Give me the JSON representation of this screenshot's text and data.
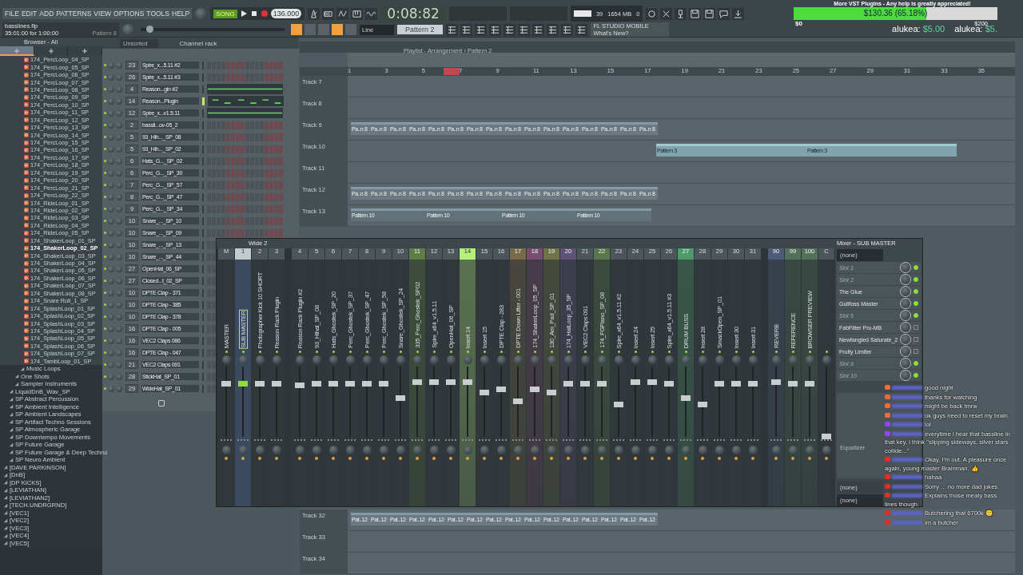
{
  "menu": [
    "FILE",
    "EDIT",
    "ADD",
    "PATTERNS",
    "VIEW",
    "OPTIONS",
    "TOOLS",
    "HELP"
  ],
  "transport": {
    "mode_label": "SONG",
    "tempo": "136.000",
    "time": "0:08:82",
    "cpu": "39",
    "memory": "1654 MB",
    "polyphony": "0"
  },
  "project": {
    "file": "basslines.flp",
    "info": "35:01:00 for 1:00:00",
    "pattern": "Pattern 8",
    "position": {
      "level": 0.04
    }
  },
  "toolbar2": {
    "snap": "Line",
    "pattern": "Pattern 2",
    "news_title": "FL STUDIO MOBILE",
    "news_link": "What's New?"
  },
  "donation": {
    "title": "More VST Plugins - Any help is greatly appreciated!",
    "amount": "$130.36 (65.18%)",
    "level": 0.6518,
    "min": "$0",
    "max": "$200",
    "donors": [
      {
        "name": "alukea:",
        "amount": "$5.00"
      },
      {
        "name": "alukea:",
        "amount": "$5."
      }
    ]
  },
  "browser": {
    "title": "Browser - All",
    "tabs": [
      {
        "selected": true
      },
      {
        "selected": false
      },
      {
        "selected": false
      }
    ],
    "tree": [
      {
        "children": [
          {
            "children": [
              {
                "children": [
                  {
                    "children": [
                      {
                        "label": "174_PercLoop_04_SP",
                        "selected": false
                      },
                      {
                        "label": "174_PercLoop_05_SP",
                        "selected": false
                      },
                      {
                        "label": "174_PercLoop_06_SP",
                        "selected": false
                      },
                      {
                        "label": "174_PercLoop_07_SP",
                        "selected": false
                      },
                      {
                        "label": "174_PercLoop_08_SP",
                        "selected": false
                      },
                      {
                        "label": "174_PercLoop_09_SP",
                        "selected": false
                      },
                      {
                        "label": "174_PercLoop_10_SP",
                        "selected": false
                      },
                      {
                        "label": "174_PercLoop_11_SP",
                        "selected": false
                      },
                      {
                        "label": "174_PercLoop_12_SP",
                        "selected": false
                      },
                      {
                        "label": "174_PercLoop_13_SP",
                        "selected": false
                      },
                      {
                        "label": "174_PercLoop_14_SP",
                        "selected": false
                      },
                      {
                        "label": "174_PercLoop_15_SP",
                        "selected": false
                      },
                      {
                        "label": "174_PercLoop_16_SP",
                        "selected": false
                      },
                      {
                        "label": "174_PercLoop_17_SP",
                        "selected": false
                      },
                      {
                        "label": "174_PercLoop_18_SP",
                        "selected": false
                      },
                      {
                        "label": "174_PercLoop_19_SP",
                        "selected": false
                      },
                      {
                        "label": "174_PercLoop_20_SP",
                        "selected": false
                      },
                      {
                        "label": "174_PercLoop_21_SP",
                        "selected": false
                      },
                      {
                        "label": "174_PercLoop_22_SP",
                        "selected": false
                      },
                      {
                        "label": "174_RideLoop_01_SP",
                        "selected": false
                      },
                      {
                        "label": "174_RideLoop_02_SP",
                        "selected": false
                      },
                      {
                        "label": "174_RideLoop_03_SP",
                        "selected": false
                      },
                      {
                        "label": "174_RideLoop_04_SP",
                        "selected": false
                      },
                      {
                        "label": "174_RideLoop_05_SP",
                        "selected": false
                      },
                      {
                        "label": "174_ShakerLoop_01_SP",
                        "selected": false
                      },
                      {
                        "label": "174_ShakerLoop_02_SP",
                        "selected": true
                      },
                      {
                        "label": "174_ShakerLoop_03_SP",
                        "selected": false
                      },
                      {
                        "label": "174_ShakerLoop_04_SP",
                        "selected": false
                      },
                      {
                        "label": "174_ShakerLoop_05_SP",
                        "selected": false
                      },
                      {
                        "label": "174_ShakerLoop_06_SP",
                        "selected": false
                      },
                      {
                        "label": "174_ShakerLoop_07_SP",
                        "selected": false
                      },
                      {
                        "label": "174_ShakerLoop_08_SP",
                        "selected": false
                      },
                      {
                        "label": "174_Snare Roll_1_SP",
                        "selected": false
                      },
                      {
                        "label": "174_SplashLoop_01_SP",
                        "selected": false
                      },
                      {
                        "label": "174_SplashLoop_02_SP",
                        "selected": false
                      },
                      {
                        "label": "174_SplashLoop_03_SP",
                        "selected": false
                      },
                      {
                        "label": "174_SplashLoop_04_SP",
                        "selected": false
                      },
                      {
                        "label": "174_SplashLoop_05_SP",
                        "selected": false
                      },
                      {
                        "label": "174_SplashLoop_06_SP",
                        "selected": false
                      },
                      {
                        "label": "174_SplashLoop_07_SP",
                        "selected": false
                      },
                      {
                        "label": "174_TambLoop_01_SP",
                        "selected": false
                      }
                    ]
                  },
                  {
                    "label": "Music Loops"
                  }
                ]
              },
              {
                "label": "One Shots"
              },
              {
                "label": "Sampler Instruments"
              }
            ]
          },
          {
            "label": "LiquidDnB_Wav_SP"
          },
          {
            "label": "SP Abstract Percussion"
          },
          {
            "label": "SP Ambient Intelligence"
          },
          {
            "label": "SP Ambient Landscapes"
          },
          {
            "label": "SP Artifact Techno Sessions"
          },
          {
            "label": "SP Atmospheric Garage"
          },
          {
            "label": "SP Downtempo Movements"
          },
          {
            "label": "SP Future Garage"
          },
          {
            "label": "SP Future Garage & Deep Techno"
          },
          {
            "label": "SP Neuro Ambient"
          }
        ]
      },
      {
        "label": "[DAVE PARKINSON]"
      },
      {
        "label": "[DnB]"
      },
      {
        "label": "[DP KICKS]"
      },
      {
        "label": "[LEVIATHAN]"
      },
      {
        "label": "[LEVIATHAN2]"
      },
      {
        "label": "[TECH.UNDRGRND]"
      },
      {
        "label": "[VEC1]"
      },
      {
        "label": "[VEC2]"
      },
      {
        "label": "[VEC3]"
      },
      {
        "label": "[VEC4]"
      },
      {
        "label": "[VEC5]"
      }
    ]
  },
  "channel_rack": {
    "title": "Channel rack",
    "filter": "Unsorted",
    "channels": [
      {
        "number": "23",
        "name": "Spire_x...5.11 #2",
        "kind": "steps",
        "selected": false
      },
      {
        "number": "26",
        "name": "Spire_x...5.11 #3",
        "kind": "steps",
        "selected": false
      },
      {
        "number": "4",
        "name": "Reason...gin #2",
        "kind": "piano",
        "selected": false
      },
      {
        "number": "14",
        "name": "Reason...Plugin",
        "kind": "piano",
        "selected": true
      },
      {
        "number": "12",
        "name": "Spire_x...v1.5.11",
        "kind": "piano",
        "selected": false
      },
      {
        "number": "2",
        "name": "bassli...ov-05_2",
        "kind": "steps",
        "selected": false
      },
      {
        "number": "5",
        "name": "93_Hih..._SP_08",
        "kind": "steps",
        "selected": false
      },
      {
        "number": "5",
        "name": "93_Hih..._SP_02",
        "kind": "steps",
        "selected": false
      },
      {
        "number": "6",
        "name": "Hats_G..._SP_02",
        "kind": "steps",
        "selected": false
      },
      {
        "number": "6",
        "name": "Perc_G..._SP_30",
        "kind": "steps",
        "selected": false
      },
      {
        "number": "7",
        "name": "Perc_G..._SP_57",
        "kind": "steps",
        "selected": false
      },
      {
        "number": "8",
        "name": "Perc_G..._SP_47",
        "kind": "steps",
        "selected": false
      },
      {
        "number": "9",
        "name": "Perc_G..._SP_34",
        "kind": "steps",
        "selected": false
      },
      {
        "number": "10",
        "name": "Snare_..._SP_10",
        "kind": "steps",
        "selected": false
      },
      {
        "number": "10",
        "name": "Snare_..._SP_09",
        "kind": "steps",
        "selected": false
      },
      {
        "number": "10",
        "name": "Snare_..._SP_13",
        "kind": "steps",
        "selected": false
      },
      {
        "number": "10",
        "name": "Snare_..._SP_44",
        "kind": "steps",
        "selected": false
      },
      {
        "number": "27",
        "name": "OpenHat_06_SP",
        "kind": "steps",
        "selected": false
      },
      {
        "number": "27",
        "name": "Closed...t_02_SP",
        "kind": "steps",
        "selected": false
      },
      {
        "number": "10",
        "name": "DPTE Clap - 371",
        "kind": "steps",
        "selected": false
      },
      {
        "number": "10",
        "name": "DPTE Clap - 385",
        "kind": "steps",
        "selected": false
      },
      {
        "number": "10",
        "name": "DPTE Clap - 378",
        "kind": "steps",
        "selected": false
      },
      {
        "number": "16",
        "name": "DPTE Clap - 005",
        "kind": "steps",
        "selected": false
      },
      {
        "number": "16",
        "name": "VEC2 Claps 086",
        "kind": "steps",
        "selected": false
      },
      {
        "number": "16",
        "name": "DPTE Clap - 047",
        "kind": "steps",
        "selected": false
      },
      {
        "number": "21",
        "name": "VEC2 Claps 091",
        "kind": "steps",
        "selected": false
      },
      {
        "number": "28",
        "name": "StickHat_SP_01",
        "kind": "steps",
        "selected": false
      },
      {
        "number": "29",
        "name": "WideHat_SP_01",
        "kind": "steps",
        "selected": false
      }
    ]
  },
  "playlist": {
    "title": "Playlist - Arrangement › Pattern 2",
    "ruler": [
      "1",
      "3",
      "5",
      "7",
      "9",
      "11",
      "13",
      "15",
      "17",
      "19",
      "21",
      "23",
      "25",
      "27",
      "29",
      "31",
      "33",
      "35"
    ],
    "tracks_top": [
      {
        "name": "Track 7"
      },
      {
        "name": "Track 8"
      },
      {
        "name": "Track 9",
        "clips": [
          {
            "label": "Pa..n 8",
            "kind": "short"
          },
          {
            "label": "Pa..n 8",
            "kind": "short"
          },
          {
            "label": "Pa..n 8",
            "kind": "short"
          },
          {
            "label": "Pa..n 8",
            "kind": "short"
          },
          {
            "label": "Pa..n 8",
            "kind": "short"
          },
          {
            "label": "Pa..n 8",
            "kind": "short"
          },
          {
            "label": "Pa..n 8",
            "kind": "short"
          },
          {
            "label": "Pa..n 8",
            "kind": "short"
          },
          {
            "label": "Pa..n 8",
            "kind": "short"
          },
          {
            "label": "Pa..n 8",
            "kind": "short"
          },
          {
            "label": "Pa..n 8",
            "kind": "short"
          },
          {
            "label": "Pa..n 8",
            "kind": "short"
          },
          {
            "label": "Pa..n 8",
            "kind": "short"
          },
          {
            "label": "Pa..n 8",
            "kind": "short"
          },
          {
            "label": "Pa..n 8",
            "kind": "short"
          },
          {
            "label": "Pa..n 8",
            "kind": "short"
          }
        ]
      },
      {
        "name": "Track 10",
        "clips": [
          {
            "label": "Pattern 3",
            "kind": "long"
          },
          {
            "label": "Pattern 3",
            "kind": "long"
          }
        ]
      },
      {
        "name": "Track 11"
      },
      {
        "name": "Track 12",
        "clips": [
          {
            "label": "Pa..n 8",
            "kind": "short"
          },
          {
            "label": "Pa..n 8",
            "kind": "short"
          },
          {
            "label": "Pa..n 8",
            "kind": "short"
          },
          {
            "label": "Pa..n 8",
            "kind": "short"
          },
          {
            "label": "Pa..n 8",
            "kind": "short"
          },
          {
            "label": "Pa..n 8",
            "kind": "short"
          },
          {
            "label": "Pa..n 8",
            "kind": "short"
          },
          {
            "label": "Pa..n 8",
            "kind": "short"
          },
          {
            "label": "Pa..n 8",
            "kind": "short"
          },
          {
            "label": "Pa..n 8",
            "kind": "short"
          },
          {
            "label": "Pa..n 8",
            "kind": "short"
          },
          {
            "label": "Pa..n 8",
            "kind": "short"
          },
          {
            "label": "Pa..n 8",
            "kind": "short"
          },
          {
            "label": "Pa..n 8",
            "kind": "short"
          },
          {
            "label": "Pa..n 8",
            "kind": "short"
          },
          {
            "label": "Pa..n 8",
            "kind": "short"
          }
        ]
      },
      {
        "name": "Track 13",
        "clips": [
          {
            "label": "Pattern 10",
            "kind": "medium"
          },
          {
            "label": "Pattern 10",
            "kind": "medium"
          },
          {
            "label": "Pattern 10",
            "kind": "medium"
          },
          {
            "label": "Pattern 10",
            "kind": "medium"
          }
        ]
      }
    ],
    "tracks_bottom": [
      {
        "name": "Track 32",
        "clips": [
          {
            "label": "Pat..12",
            "kind": "short"
          },
          {
            "label": "Pat..12",
            "kind": "short"
          },
          {
            "label": "Pat..12",
            "kind": "short"
          },
          {
            "label": "Pat..12",
            "kind": "short"
          },
          {
            "label": "Pat..12",
            "kind": "short"
          },
          {
            "label": "Pat..12",
            "kind": "short"
          },
          {
            "label": "Pat..12",
            "kind": "short"
          },
          {
            "label": "Pat..12",
            "kind": "short"
          },
          {
            "label": "Pat..12",
            "kind": "short"
          },
          {
            "label": "Pat..12",
            "kind": "short"
          },
          {
            "label": "Pat..12",
            "kind": "short"
          },
          {
            "label": "Pat..12",
            "kind": "short"
          },
          {
            "label": "Pat..12",
            "kind": "short"
          },
          {
            "label": "Pat..12",
            "kind": "short"
          },
          {
            "label": "Pat..12",
            "kind": "short"
          },
          {
            "label": "Pat..12",
            "kind": "short"
          }
        ]
      },
      {
        "name": "Track 33"
      },
      {
        "name": "Track 34"
      }
    ]
  },
  "mixer": {
    "preset": "Wide 2",
    "strips": [
      {
        "number": "M",
        "name": "MASTER",
        "selected": false,
        "level": 0.75
      },
      {
        "number": "1",
        "name": "SUB MASTER",
        "selected": true,
        "level": 0.75
      },
      {
        "number": "2",
        "name": "Photographer Kick 10 SHORT",
        "selected": false,
        "level": 0.75
      },
      {
        "number": "3",
        "name": "Reason Rack Plugin",
        "selected": false,
        "level": 0.75
      },
      {
        "number": "4",
        "name": "Reason Rack Plugin #2",
        "selected": false,
        "level": 0.73
      },
      {
        "number": "5",
        "name": "93_Hihat_SP_08",
        "selected": false,
        "level": 0.75
      },
      {
        "number": "6",
        "name": "Hats_Ghostek_SP_20",
        "selected": false,
        "level": 0.75
      },
      {
        "number": "7",
        "name": "Perc_Ghostek_SP_37",
        "selected": false,
        "level": 0.75
      },
      {
        "number": "8",
        "name": "Perc_Ghostek_SP_47",
        "selected": false,
        "level": 0.75
      },
      {
        "number": "9",
        "name": "Perc_Ghostek_SP_58",
        "selected": false,
        "level": 0.75
      },
      {
        "number": "10",
        "name": "Snare_Ghostek_SP_24",
        "selected": false,
        "level": 0.55
      },
      {
        "number": "11",
        "name": "335_Perc_Ghostek_SP02",
        "selected": false,
        "level": 0.77,
        "color": "#5f7d45"
      },
      {
        "number": "12",
        "name": "Spire_x64_v1.5.11",
        "selected": false,
        "level": 0.77
      },
      {
        "number": "13",
        "name": "OpenHat_06_SP",
        "selected": false,
        "level": 0.77
      },
      {
        "number": "14",
        "name": "Insert 14",
        "selected": false,
        "level": 0.77,
        "color": "#b4f07c"
      },
      {
        "number": "15",
        "name": "Insert 15",
        "selected": false,
        "level": 0.62
      },
      {
        "number": "16",
        "name": "DPTE Clap - 283",
        "selected": false,
        "level": 0.67
      },
      {
        "number": "17",
        "name": "DPTE Down Lifter - 001",
        "selected": false,
        "level": 0.5,
        "color": "#7a6a4c"
      },
      {
        "number": "18",
        "name": "174_ShakerLoop_05_SP",
        "selected": false,
        "level": 0.67,
        "color": "#7a4c6e"
      },
      {
        "number": "19",
        "name": "130_Am_Pad_SP_01",
        "selected": false,
        "level": 0.62,
        "color": "#6f7448"
      },
      {
        "number": "20",
        "name": "174_HatLoop_35_SP",
        "selected": false,
        "level": 0.75,
        "color": "#5e5278"
      },
      {
        "number": "21",
        "name": "VEC2 Claps 091",
        "selected": false,
        "level": 0.75
      },
      {
        "number": "22",
        "name": "174_FGPiano_SP_08",
        "selected": false,
        "level": 0.75,
        "color": "#58784c"
      },
      {
        "number": "23",
        "name": "Spire_x64_v1.5.11 #2",
        "selected": false,
        "level": 0.45
      },
      {
        "number": "24",
        "name": "Insert 24",
        "selected": false,
        "level": 0.77
      },
      {
        "number": "25",
        "name": "Insert 25",
        "selected": false,
        "level": 0.77
      },
      {
        "number": "26",
        "name": "Spire_x64_v1.5.11 #3",
        "selected": false,
        "level": 0.75
      },
      {
        "number": "27",
        "name": "DRUM BUSS",
        "selected": false,
        "level": 0.55,
        "color": "#4f9a6a"
      },
      {
        "number": "28",
        "name": "Insert 28",
        "selected": false,
        "level": 0.45
      },
      {
        "number": "29",
        "name": "SmackOpen_SP_01",
        "selected": false,
        "level": 0.75
      },
      {
        "number": "30",
        "name": "Insert 30",
        "selected": false,
        "level": 0.75
      },
      {
        "number": "31",
        "name": "Insert 31",
        "selected": false,
        "level": 0.75
      },
      {
        "number": "90",
        "name": "REVERB",
        "selected": false,
        "level": 0.77,
        "color": "#4d5a78"
      },
      {
        "number": "99",
        "name": "REFERENCE",
        "selected": false,
        "level": 0.75,
        "color": "#52705a"
      },
      {
        "number": "100",
        "name": "BROWSER PREVIEW",
        "selected": false,
        "level": 0.75,
        "color": "#52705a"
      },
      {
        "number": "C",
        "selected": false,
        "level": 0.0
      }
    ]
  },
  "insert_panel": {
    "title": "Mixer - SUB MASTER",
    "input": "(none)",
    "slots": [
      {
        "name": "Slot 1",
        "empty": true,
        "on": true
      },
      {
        "name": "Slot 2",
        "empty": true,
        "on": true
      },
      {
        "name": "The Glue",
        "empty": false,
        "on": true
      },
      {
        "name": "Gullfoss Master",
        "empty": false,
        "on": true
      },
      {
        "name": "Slot 5",
        "empty": true,
        "on": true
      },
      {
        "name": "FabFilter Pro-MB",
        "empty": false,
        "on": false
      },
      {
        "name": "Newfangled Saturate_2",
        "empty": false,
        "on": false
      },
      {
        "name": "Fruity Limiter",
        "empty": false,
        "on": false
      },
      {
        "name": "Slot 9",
        "empty": true,
        "on": true
      },
      {
        "name": "Slot 10",
        "empty": true,
        "on": true
      }
    ],
    "eq_label": "Equalizer",
    "send": "(none)",
    "output": "(none)"
  },
  "chat": [
    {
      "kind": "restream",
      "text": "good night"
    },
    {
      "kind": "restream",
      "text": "thanks for watching"
    },
    {
      "kind": "restream",
      "text": "might be back tmrw"
    },
    {
      "kind": "restream",
      "text": "ok guys need to reset my brain"
    },
    {
      "kind": "twitch",
      "text": "lol"
    },
    {
      "kind": "twitch",
      "text": "everytime i hear that bassline in that key, i think \"slipping sideways, silver stars collide...\""
    },
    {
      "kind": "youtube",
      "text": "Okay, I'm out. A pleasure once again, young master Brainman. 👍"
    },
    {
      "kind": "youtube",
      "text": "hahaa"
    },
    {
      "kind": "youtube",
      "text": "Sorry ... no more dad jokes."
    },
    {
      "kind": "youtube",
      "text": "Explains those meaty bass lines though."
    },
    {
      "kind": "youtube",
      "text": "Butchering that 6700k 🙂"
    },
    {
      "kind": "youtube",
      "text": "im a butcher"
    }
  ]
}
